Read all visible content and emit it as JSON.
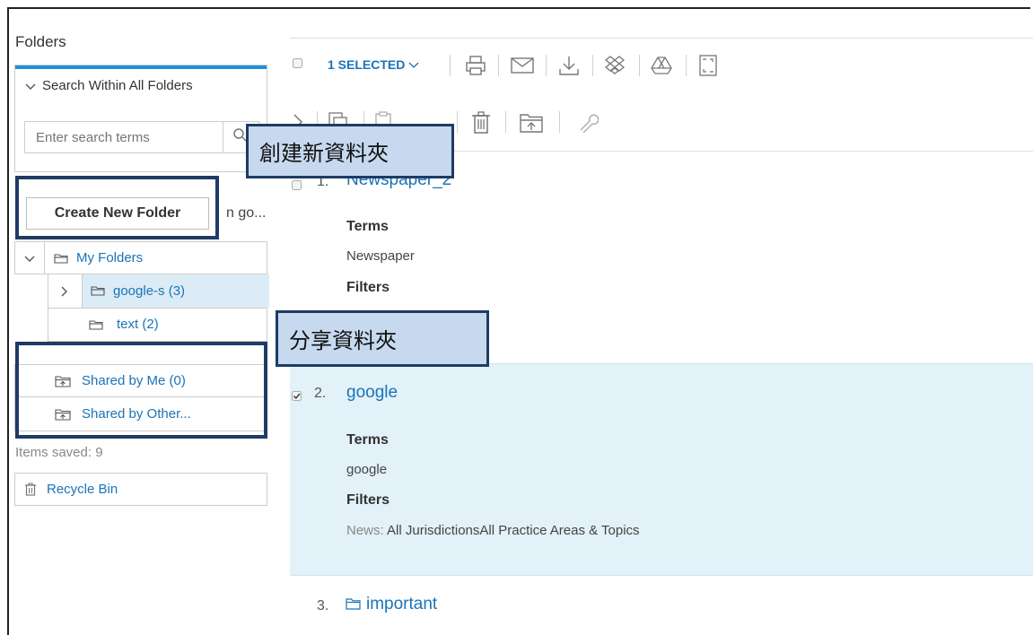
{
  "sidebar": {
    "title": "Folders",
    "search_toggle_label": "Search Within All Folders",
    "search_placeholder": "Enter search terms",
    "create_button_label": "Create New Folder",
    "truncated_text": "n go...",
    "tree": {
      "my_folders": "My Folders",
      "google_s": "google-s (3)",
      "text": "text (2)",
      "shared_by_me": "Shared by Me (0)",
      "shared_by_others": "Shared by Other..."
    },
    "items_saved": "Items saved: 9",
    "recycle_bin": "Recycle Bin"
  },
  "toolbar": {
    "selected_label": "1 SELECTED"
  },
  "results": [
    {
      "index": "1.",
      "title": "Newspaper_2",
      "terms_label": "Terms",
      "terms_value": "Newspaper",
      "filters_label": "Filters"
    },
    {
      "index": "2.",
      "title": "google",
      "terms_label": "Terms",
      "terms_value": "google",
      "filters_label": "Filters",
      "filters_key": "News:",
      "filters_value": "All JurisdictionsAll Practice Areas & Topics",
      "checked": true
    },
    {
      "index": "3.",
      "title": "important"
    }
  ],
  "annotations": {
    "create_folder": "創建新資料夾",
    "share_folder": "分享資料夾"
  },
  "colors": {
    "link": "#1a73b8",
    "accent_bar": "#1e90d6",
    "selected_row_bg": "#e3f1f8",
    "callout_bg": "#c7d9ef",
    "callout_border": "#1f3b66"
  }
}
